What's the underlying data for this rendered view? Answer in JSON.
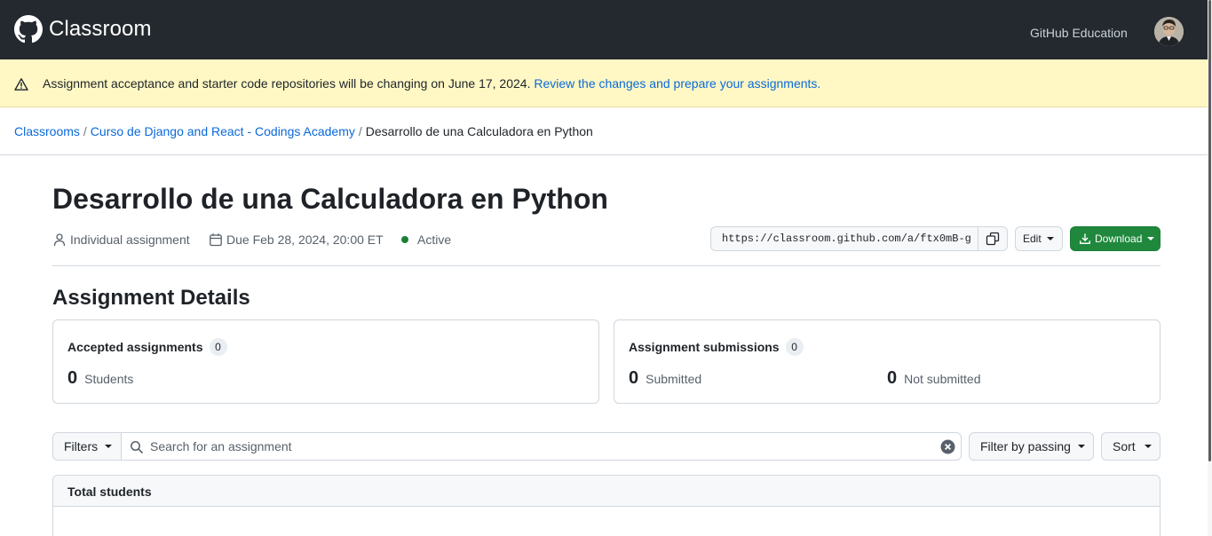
{
  "header": {
    "app_title": "Classroom",
    "nav_link": "GitHub Education",
    "logo_icon": "github-mark-icon",
    "avatar_icon": "user-avatar"
  },
  "banner": {
    "message": "Assignment acceptance and starter code repositories will be changing on June 17, 2024.",
    "link_text": "Review the changes and prepare your assignments.",
    "icon": "alert-icon"
  },
  "breadcrumb": {
    "items": [
      "Classrooms",
      "Curso de Django and React - Codings Academy"
    ],
    "separator": "/",
    "current": "Desarrollo de una Calculadora en Python"
  },
  "assignment": {
    "title": "Desarrollo de una Calculadora en Python",
    "type": "Individual assignment",
    "due": "Due Feb 28, 2024, 20:00 ET",
    "status": "Active",
    "status_color": "#1a7f37",
    "invite_url": "https://classroom.github.com/a/ftx0mB-g",
    "edit_label": "Edit",
    "download_label": "Download"
  },
  "details": {
    "title": "Assignment Details",
    "accepted": {
      "label": "Accepted assignments",
      "count": "0",
      "students_value": "0",
      "students_label": "Students"
    },
    "submissions": {
      "label": "Assignment submissions",
      "count": "0",
      "submitted_value": "0",
      "submitted_label": "Submitted",
      "not_submitted_value": "0",
      "not_submitted_label": "Not submitted"
    }
  },
  "toolbar": {
    "filters_label": "Filters",
    "search_placeholder": "Search for an assignment",
    "filter_passing_label": "Filter by passing",
    "sort_label": "Sort"
  },
  "table": {
    "header": "Total students"
  },
  "colors": {
    "topbar": "#24292f",
    "banner": "#fff8c5",
    "link": "#0969da",
    "primary_button": "#1f883d"
  }
}
